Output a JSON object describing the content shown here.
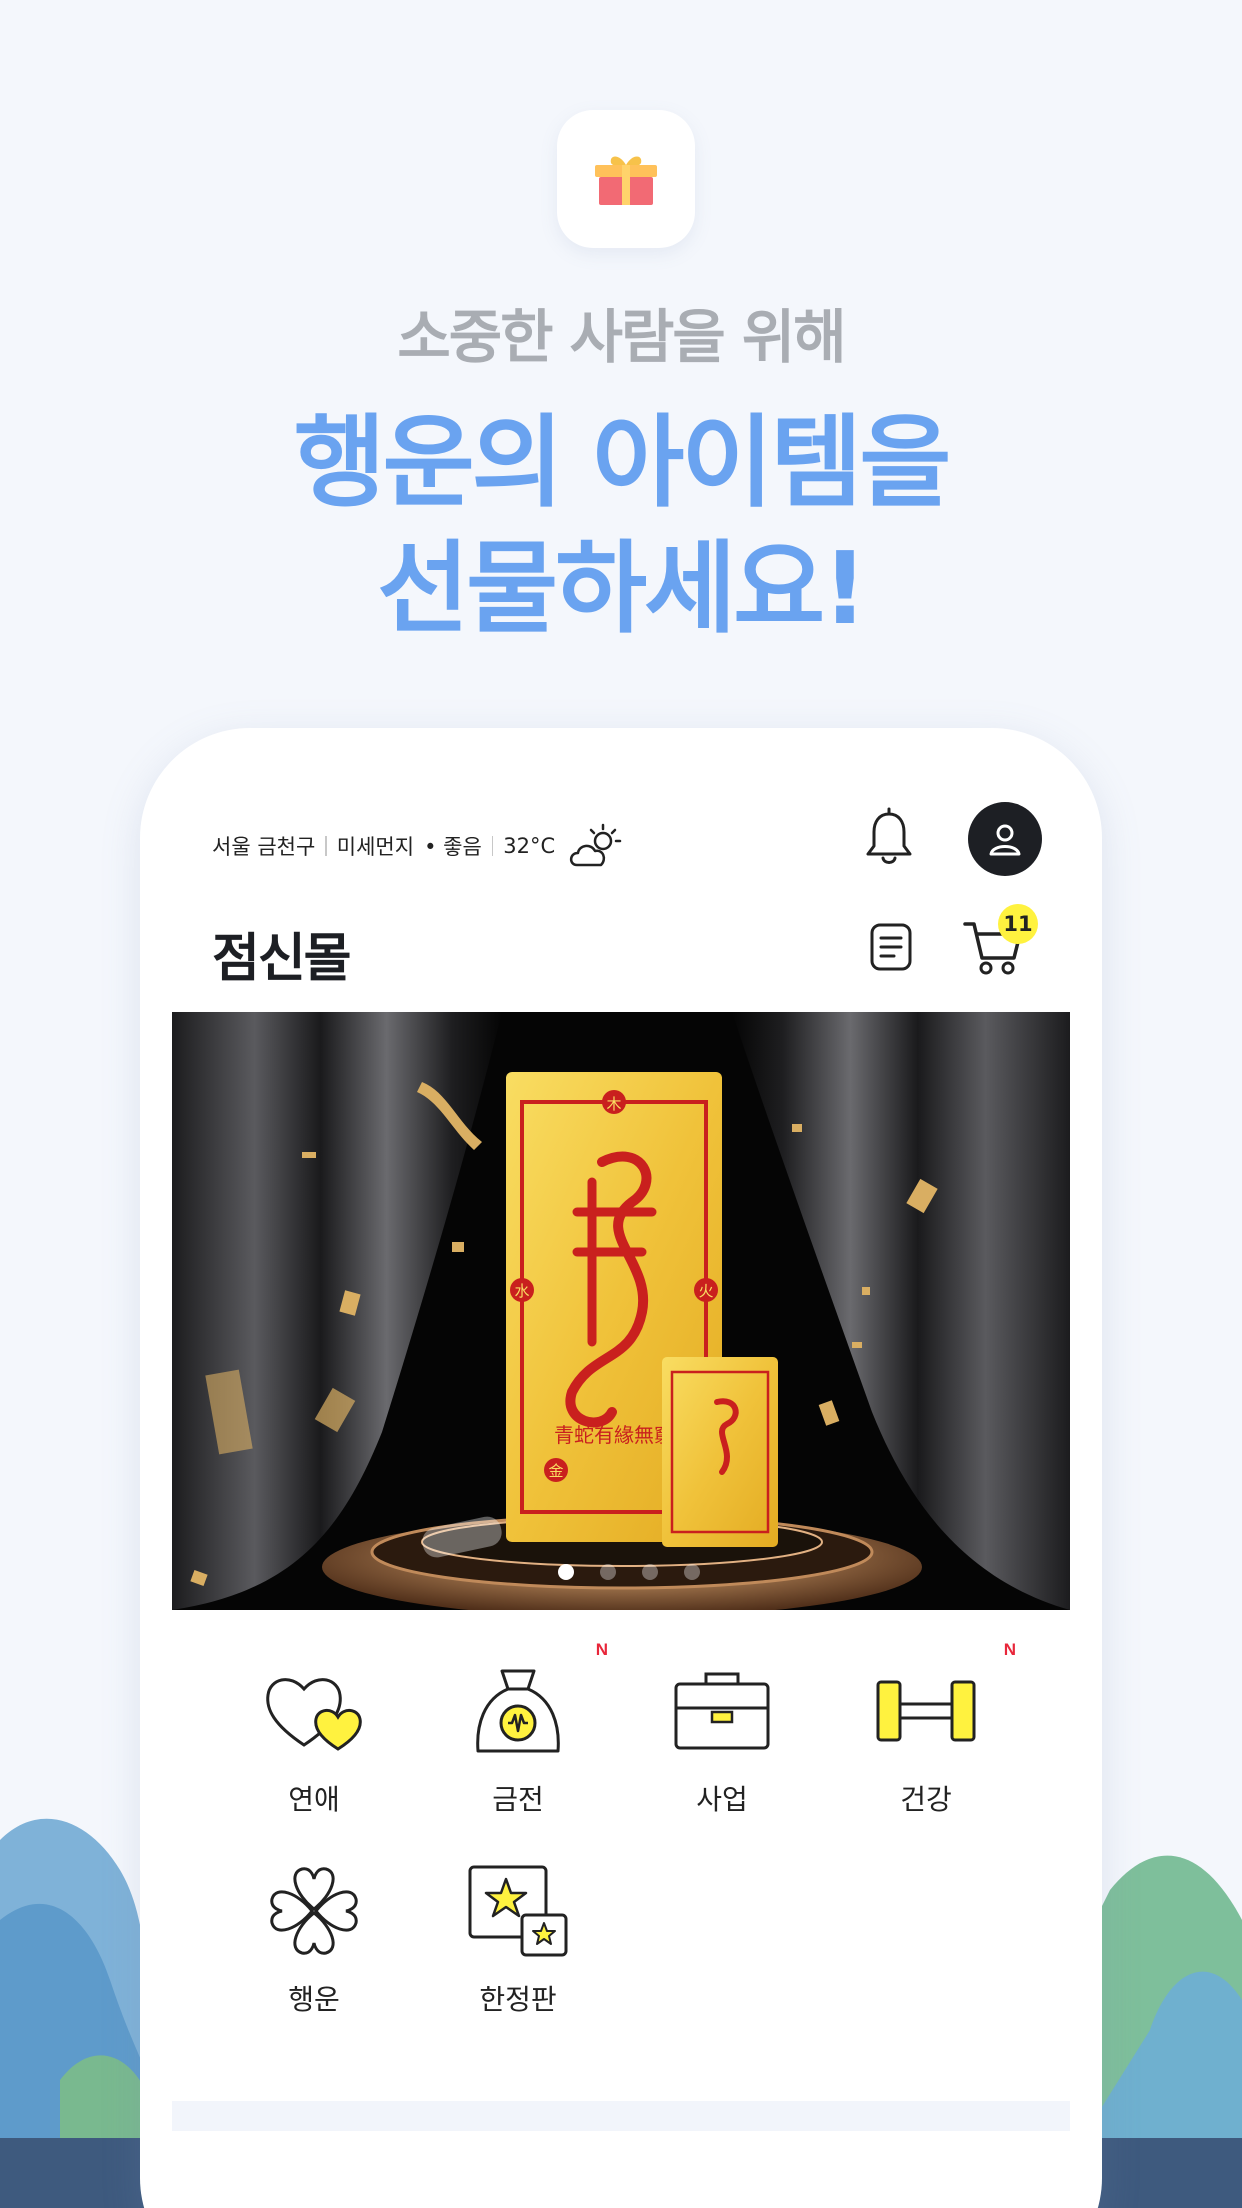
{
  "promo": {
    "subtitle": "소중한 사람을 위해",
    "headline_line1": "행운의 아이템을",
    "headline_line2": "선물하세요!"
  },
  "status": {
    "location": "서울 금천구",
    "air": "미세먼지",
    "air_quality": "• 좋음",
    "temperature": "32°C"
  },
  "app": {
    "title": "점신몰",
    "cart_count": "11"
  },
  "banner": {
    "slide_count": 4,
    "active_slide": 1,
    "talisman_text": "青蛇有緣無窮",
    "element_top": "木",
    "element_left": "水",
    "element_right": "火",
    "element_bottom": "金"
  },
  "categories": [
    {
      "label": "연애",
      "icon": "heart-icon",
      "new": false
    },
    {
      "label": "금전",
      "icon": "money-bag-icon",
      "new": true
    },
    {
      "label": "사업",
      "icon": "briefcase-icon",
      "new": false
    },
    {
      "label": "건강",
      "icon": "dumbbell-icon",
      "new": true
    },
    {
      "label": "행운",
      "icon": "clover-icon",
      "new": false
    },
    {
      "label": "한정판",
      "icon": "limited-star-icon",
      "new": false
    }
  ],
  "badges": {
    "new_label": "N"
  },
  "colors": {
    "headline": "#6aa3f0",
    "subtitle": "#a9adb3",
    "accent_yellow": "#fff23f",
    "new_badge": "#e8263a"
  }
}
